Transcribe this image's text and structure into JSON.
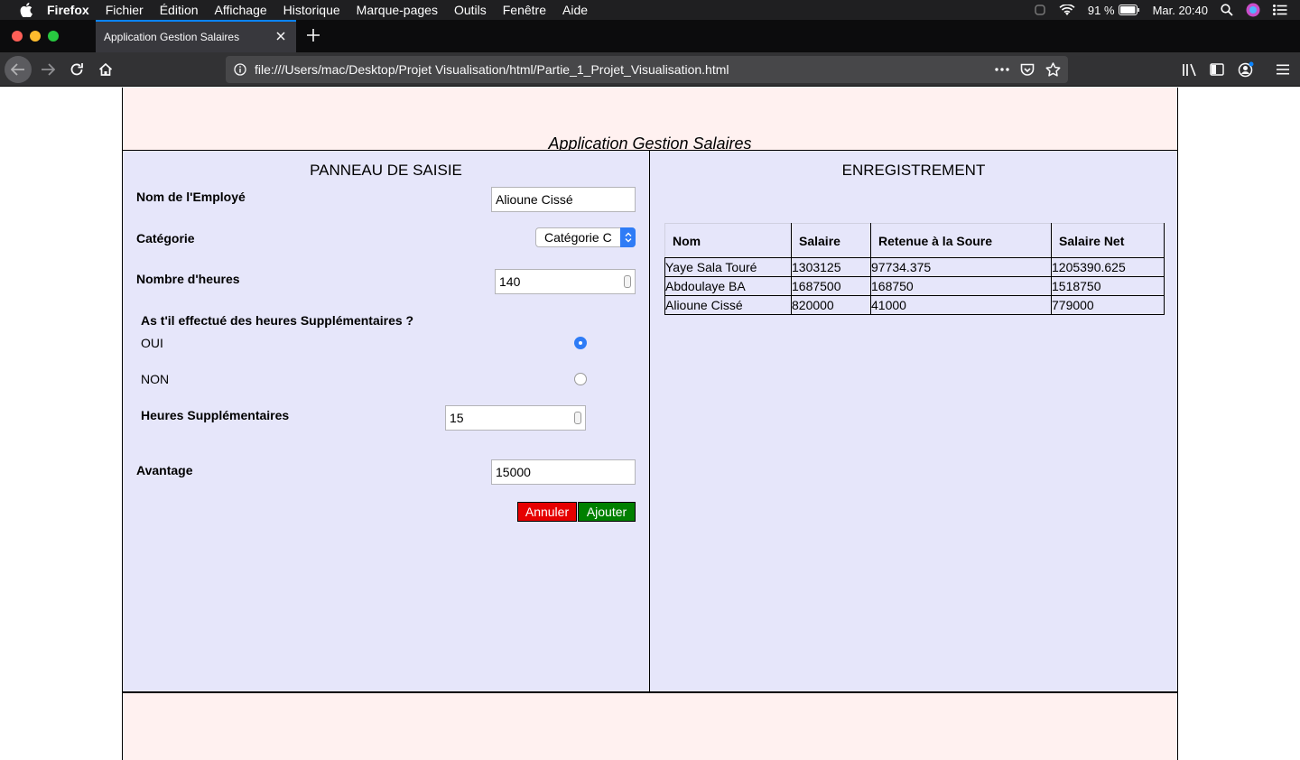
{
  "menubar": {
    "app_name": "Firefox",
    "items": [
      "Fichier",
      "Édition",
      "Affichage",
      "Historique",
      "Marque-pages",
      "Outils",
      "Fenêtre",
      "Aide"
    ],
    "battery": "91 %",
    "clock": "Mar. 20:40"
  },
  "browser": {
    "tab_title": "Application Gestion Salaires",
    "url": "file:///Users/mac/Desktop/Projet Visualisation/html/Partie_1_Projet_Visualisation.html"
  },
  "page": {
    "title": "Application Gestion Salaires",
    "form": {
      "panel_title": "PANNEAU DE SAISIE",
      "employee_label": "Nom de l'Employé",
      "employee_value": "Alioune Cissé",
      "category_label": "Catégorie",
      "category_value": "Catégorie C",
      "hours_label": "Nombre d'heures",
      "hours_value": "140",
      "overtime_question": "As t'il effectué des heures Supplémentaires ?",
      "yes_label": "OUI",
      "no_label": "NON",
      "overtime_selected": "OUI",
      "overtime_hours_label": "Heures Supplémentaires",
      "overtime_hours_value": "15",
      "benefit_label": "Avantage",
      "benefit_value": "15000",
      "cancel_label": "Annuler",
      "add_label": "Ajouter"
    },
    "records": {
      "panel_title": "ENREGISTREMENT",
      "columns": [
        "Nom",
        "Salaire",
        "Retenue à la Soure",
        "Salaire Net"
      ],
      "rows": [
        [
          "Yaye Sala Touré",
          "1303125",
          "97734.375",
          "1205390.625"
        ],
        [
          "Abdoulaye BA",
          "1687500",
          "168750",
          "1518750"
        ],
        [
          "Alioune Cissé",
          "820000",
          "41000",
          "779000"
        ]
      ]
    }
  },
  "colors": {
    "panel_bg": "#e6e6fa",
    "header_bg": "#fff1f0",
    "cancel_bg": "#e60000",
    "add_bg": "#008000",
    "accent": "#2f7cf6"
  }
}
